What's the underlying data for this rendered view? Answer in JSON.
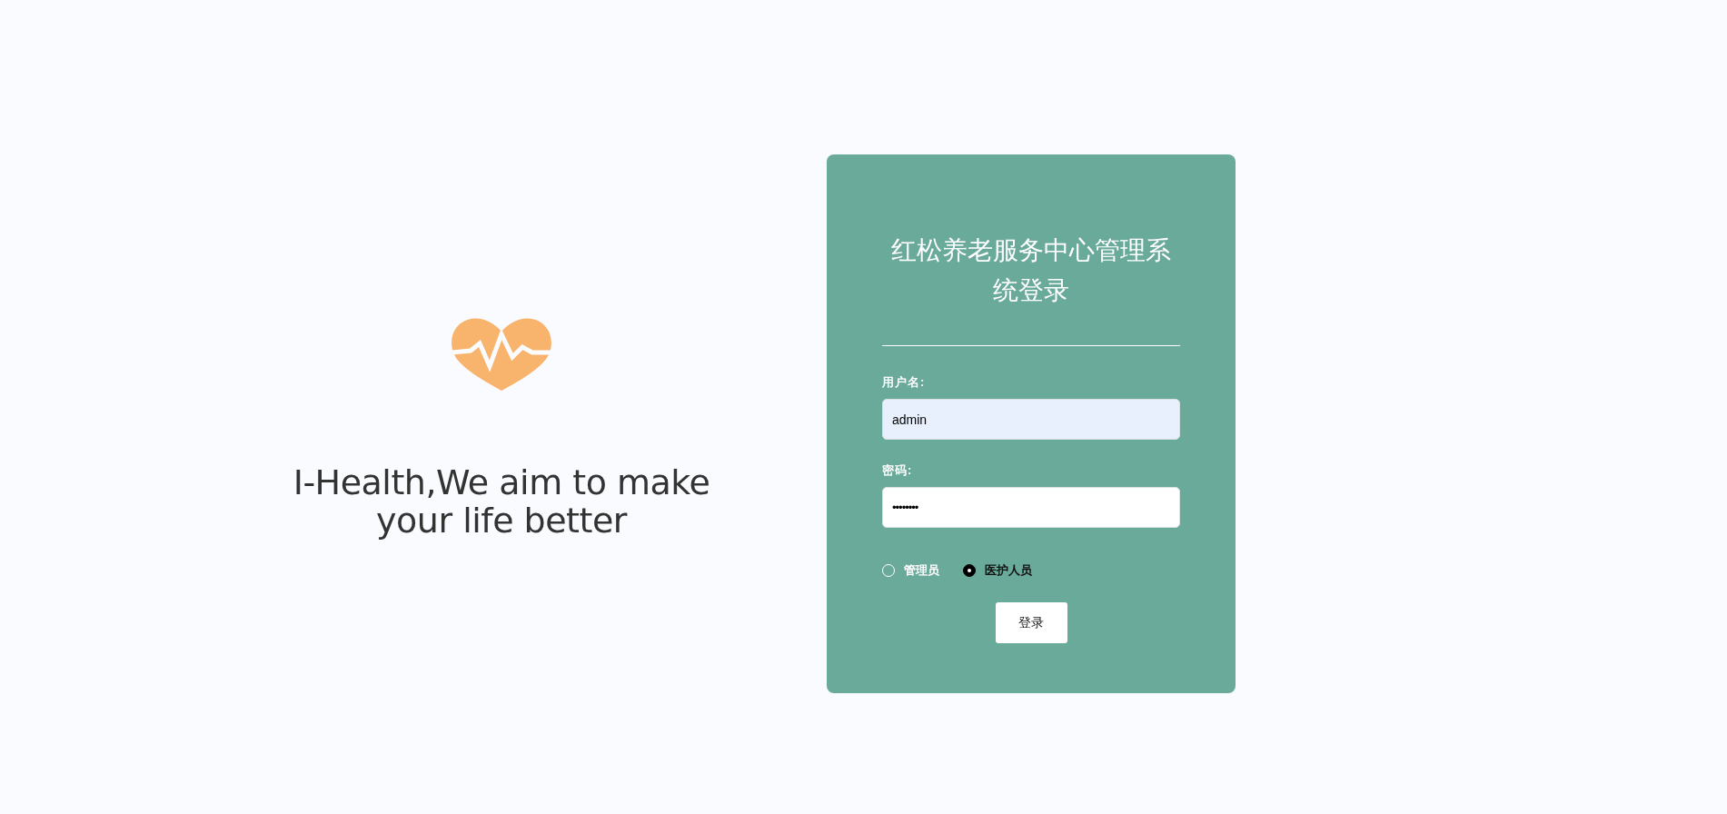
{
  "brand": {
    "tagline": "I-Health,We aim to make your life better"
  },
  "login": {
    "title": "红松养老服务中心管理系统登录",
    "fields": [
      {
        "label": "用户名:",
        "value": "admin",
        "kind": "text",
        "autofilled": true
      },
      {
        "label": "密码:",
        "value": "••••••••",
        "kind": "password",
        "autofilled": false
      }
    ],
    "roles": [
      {
        "label": "管理员",
        "selected": false
      },
      {
        "label": "医护人员",
        "selected": true
      }
    ],
    "submit": "登录"
  }
}
